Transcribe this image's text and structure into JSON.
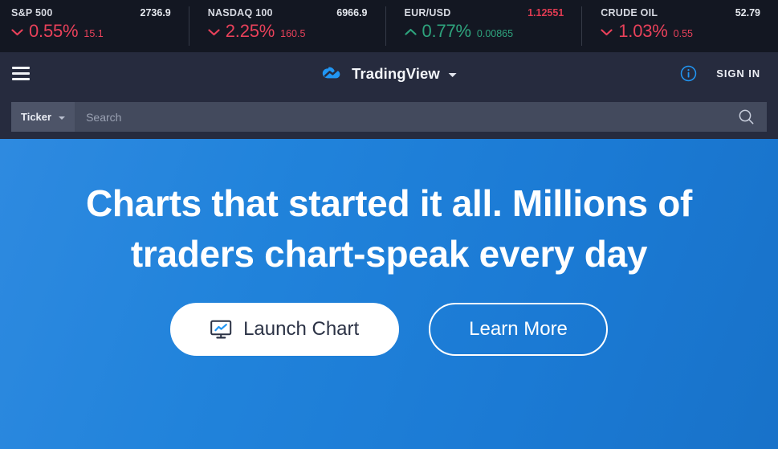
{
  "tickers": [
    {
      "symbol": "S&P 500",
      "price": "2736.9",
      "price_down": false,
      "direction": "down",
      "percent": "0.55%",
      "change": "15.1"
    },
    {
      "symbol": "NASDAQ 100",
      "price": "6966.9",
      "price_down": false,
      "direction": "down",
      "percent": "2.25%",
      "change": "160.5"
    },
    {
      "symbol": "EUR/USD",
      "price": "1.12551",
      "price_down": true,
      "direction": "up",
      "percent": "0.77%",
      "change": "0.00865"
    },
    {
      "symbol": "CRUDE OIL",
      "price": "52.79",
      "price_down": false,
      "direction": "down",
      "percent": "1.03%",
      "change": "0.55"
    }
  ],
  "nav": {
    "menu_icon": "hamburger-icon",
    "brand_name": "TradingView",
    "brand_logo_icon": "tradingview-cloud-logo",
    "brand_caret_icon": "chevron-down-icon",
    "info_icon": "info-circle-icon",
    "signin_label": "SIGN IN"
  },
  "search": {
    "filter_label": "Ticker",
    "filter_caret_icon": "chevron-down-icon",
    "placeholder": "Search",
    "value": "",
    "search_icon": "search-icon"
  },
  "hero": {
    "title": "Charts that started it all. Millions of traders chart-speak every day",
    "launch_label": "Launch Chart",
    "launch_icon": "monitor-chart-icon",
    "learn_label": "Learn More"
  },
  "colors": {
    "ticker_bg": "#131722",
    "nav_bg": "#262b3e",
    "down_red": "#e8415a",
    "up_green": "#2ea37d",
    "hero_blue": "#2183db",
    "accent_blue": "#2196f3",
    "white": "#ffffff"
  }
}
